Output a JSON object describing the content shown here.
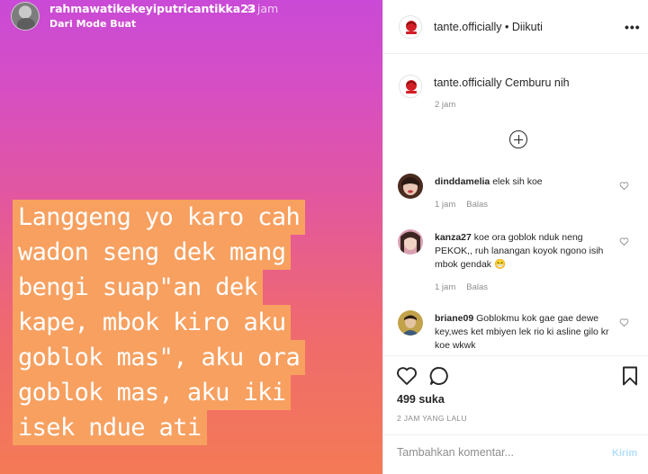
{
  "story": {
    "username": "rahmawatikekeyiputricantikka23",
    "time": "9 jam",
    "subtitle": "Dari Mode Buat",
    "lines": [
      "Langgeng yo karo cah",
      "wadon seng dek mang",
      "bengi suap\"an dek",
      "kape, mbok kiro aku",
      "goblok mas\", aku ora",
      "goblok mas, aku iki",
      "isek ndue ati"
    ],
    "text_bg_color": "#f7a060"
  },
  "header": {
    "username": "tante.officially",
    "separator": " • ",
    "follow_status": "Diikuti",
    "more_icon": "more-dots-icon"
  },
  "caption": {
    "username": "tante.officially",
    "text": "Cemburu nih",
    "time": "2 jam"
  },
  "load_more_icon": "plus-circle-icon",
  "comments": [
    {
      "username": "dinddamelia",
      "text": "elek sih koe",
      "time": "1 jam",
      "reply": "Balas"
    },
    {
      "username": "kanza27",
      "text": "koe ora goblok nduk neng PEKOK,, ruh lanangan koyok ngono isih mbok gendak 😁",
      "time": "1 jam",
      "reply": "Balas"
    },
    {
      "username": "briane09",
      "text": "Goblokmu kok gae gae dewe key,wes ket mbiyen lek rio ki asline gilo kr koe wkwk",
      "time": "",
      "reply": ""
    }
  ],
  "post": {
    "likes": "499 suka",
    "time": "2 JAM YANG LALU"
  },
  "comment_box": {
    "placeholder": "Tambahkan komentar...",
    "send_label": "Kirim"
  },
  "colors": {
    "accent_link": "#b2dffc",
    "muted_text": "#8e8e8e"
  }
}
